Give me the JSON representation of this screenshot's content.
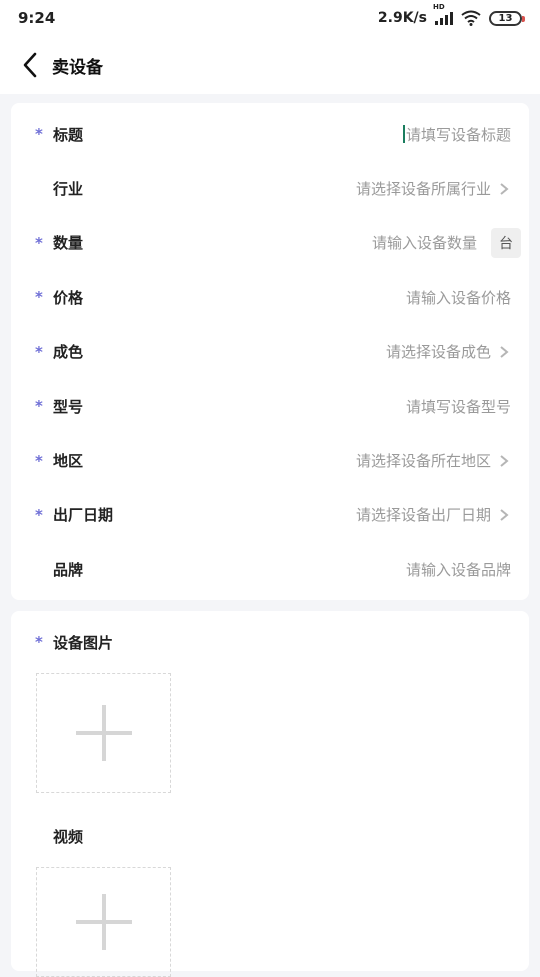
{
  "status_bar": {
    "time": "9:24",
    "net_speed": "2.9K/s",
    "signal_tag": "HD",
    "battery": "13"
  },
  "nav": {
    "title": "卖设备",
    "back_icon": "chevron-left-icon"
  },
  "required_mark": "*",
  "form": {
    "fields": [
      {
        "label": "标题",
        "required": true,
        "placeholder": "请填写设备标题",
        "type": "text",
        "focused": true
      },
      {
        "label": "行业",
        "required": false,
        "placeholder": "请选择设备所属行业",
        "type": "select"
      },
      {
        "label": "数量",
        "required": true,
        "placeholder": "请输入设备数量",
        "type": "number",
        "unit": "台"
      },
      {
        "label": "价格",
        "required": true,
        "placeholder": "请输入设备价格",
        "type": "text"
      },
      {
        "label": "成色",
        "required": true,
        "placeholder": "请选择设备成色",
        "type": "select"
      },
      {
        "label": "型号",
        "required": true,
        "placeholder": "请填写设备型号",
        "type": "text"
      },
      {
        "label": "地区",
        "required": true,
        "placeholder": "请选择设备所在地区",
        "type": "select"
      },
      {
        "label": "出厂日期",
        "required": true,
        "placeholder": "请选择设备出厂日期",
        "type": "select"
      },
      {
        "label": "品牌",
        "required": false,
        "placeholder": "请输入设备品牌",
        "type": "text"
      }
    ]
  },
  "media": {
    "images_label": "设备图片",
    "images_required": true,
    "video_label": "视频",
    "video_required": false
  },
  "colors": {
    "accent_star": "#6f6fd6",
    "caret": "#1a7d5e",
    "placeholder": "#9a9a9a",
    "background": "#f4f5f8"
  }
}
